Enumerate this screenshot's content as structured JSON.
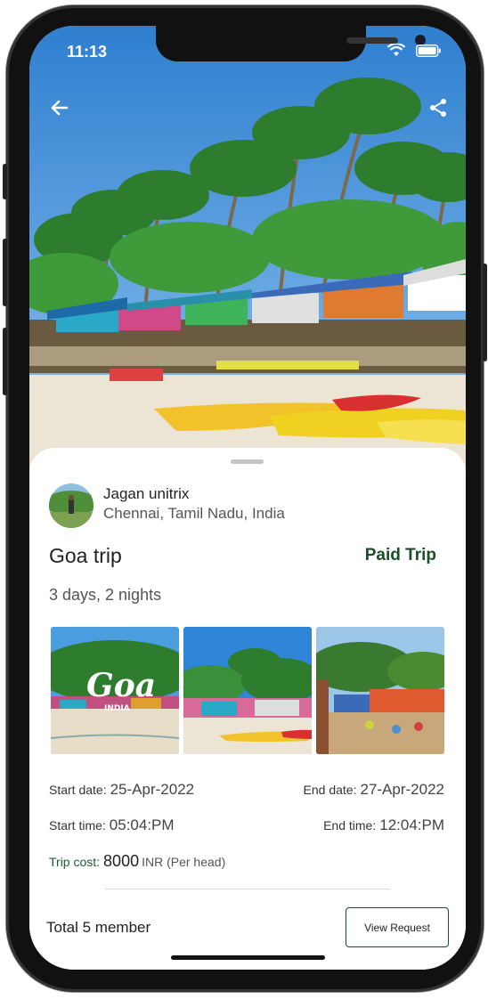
{
  "status_bar": {
    "time": "11:13"
  },
  "header": {
    "back_icon": "arrow-left-icon",
    "share_icon": "share-icon"
  },
  "organizer": {
    "name": "Jagan unitrix",
    "location": "Chennai, Tamil Nadu, India"
  },
  "trip": {
    "title": "Goa trip",
    "badge": "Paid Trip",
    "duration": "3 days, 2 nights",
    "gallery": [
      {
        "caption": "Goa",
        "subcaption": "INDIA"
      },
      {
        "caption": ""
      },
      {
        "caption": ""
      }
    ],
    "start_date_label": "Start date:",
    "start_date": "25-Apr-2022",
    "end_date_label": "End date:",
    "end_date": "27-Apr-2022",
    "start_time_label": "Start time:",
    "start_time": "05:04:PM",
    "end_time_label": "End time:",
    "end_time": "12:04:PM",
    "cost_label": "Trip cost:",
    "cost_value": "8000",
    "cost_unit": "INR (Per head)"
  },
  "footer": {
    "members": "Total 5 member",
    "view_request_label": "View Request"
  },
  "colors": {
    "accent": "#1b4d2b",
    "sky": "#3f8fd6",
    "sand": "#ece4d4"
  }
}
